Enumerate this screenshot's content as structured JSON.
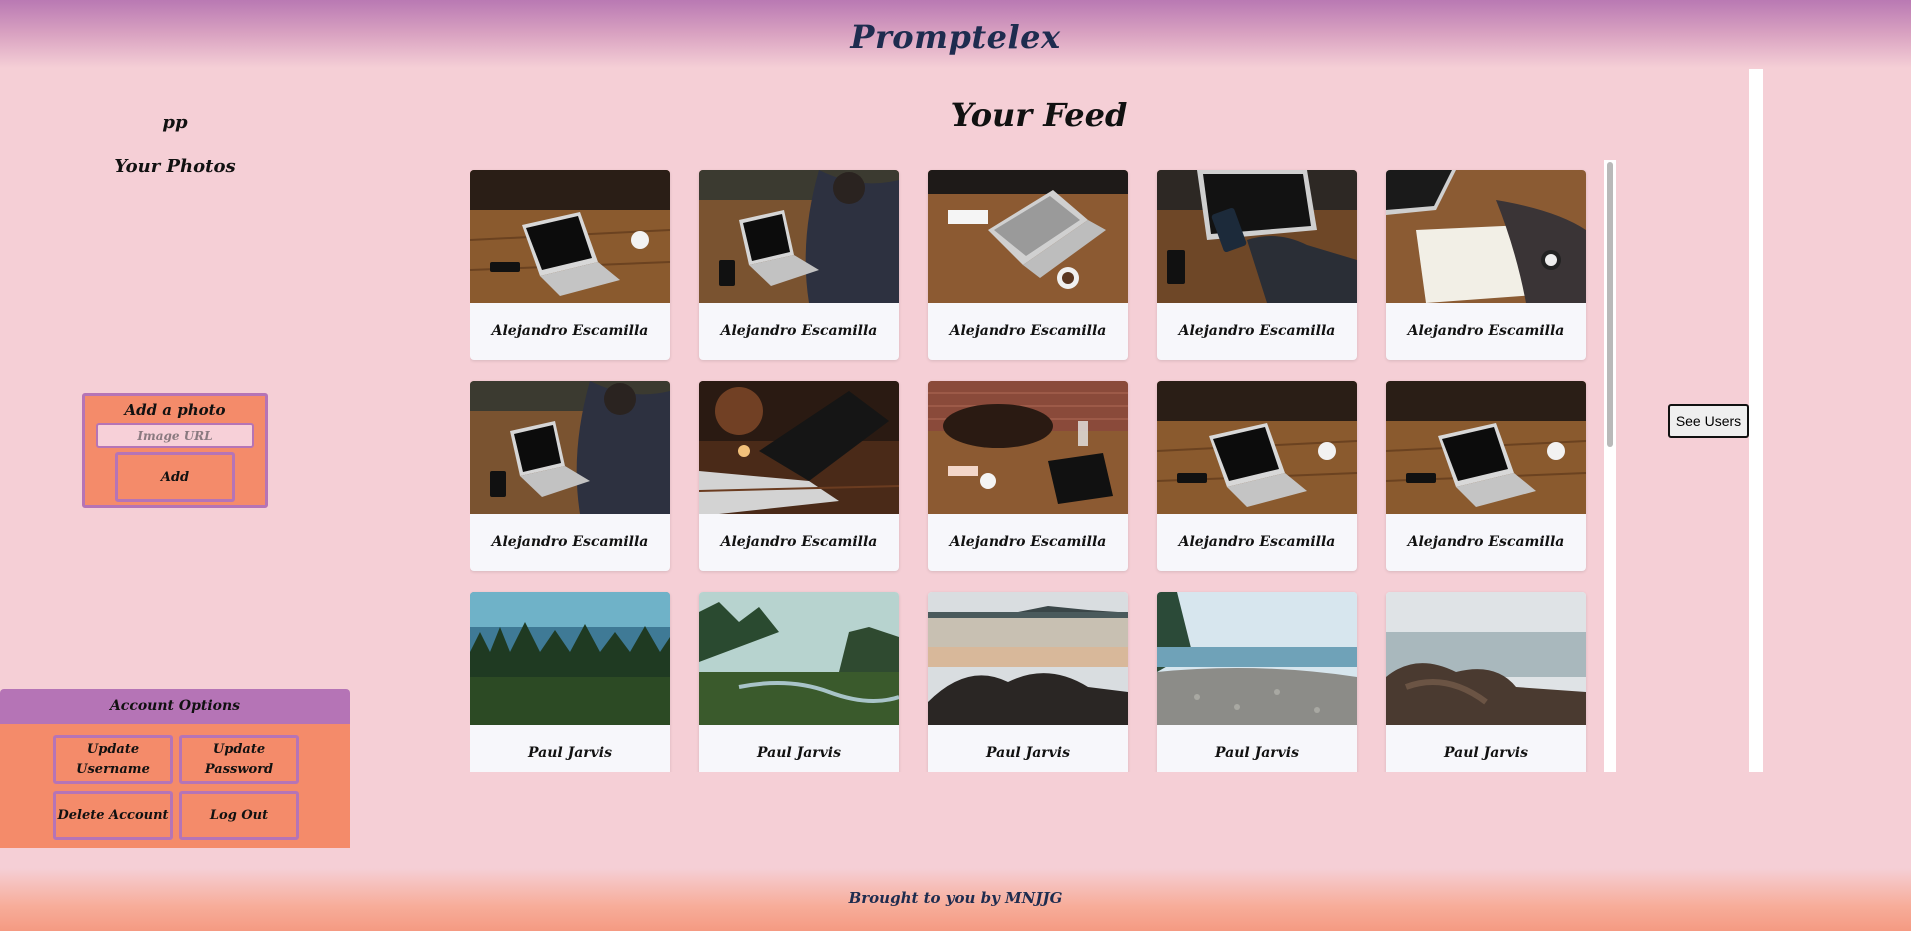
{
  "header": {
    "title": "Promptelex"
  },
  "sidebar": {
    "username": "pp",
    "your_photos_label": "Your Photos",
    "add_photo": {
      "title": "Add a photo",
      "input_placeholder": "Image URL",
      "input_value": "",
      "add_button_label": "Add"
    },
    "account_options": {
      "title": "Account Options",
      "buttons": [
        "Update Username",
        "Update Password",
        "Delete Account",
        "Log Out"
      ]
    }
  },
  "feed": {
    "title": "Your Feed",
    "cards": [
      {
        "author": "Alejandro Escamilla",
        "photo": "laptop-on-table-overhead"
      },
      {
        "author": "Alejandro Escamilla",
        "photo": "person-typing-laptop"
      },
      {
        "author": "Alejandro Escamilla",
        "photo": "laptop-with-coffee"
      },
      {
        "author": "Alejandro Escamilla",
        "photo": "phone-over-laptop"
      },
      {
        "author": "Alejandro Escamilla",
        "photo": "writing-notebook"
      },
      {
        "author": "Alejandro Escamilla",
        "photo": "person-typing-laptop"
      },
      {
        "author": "Alejandro Escamilla",
        "photo": "laptop-dim-table"
      },
      {
        "author": "Alejandro Escamilla",
        "photo": "bag-and-tablet-brick"
      },
      {
        "author": "Alejandro Escamilla",
        "photo": "laptop-on-table-overhead"
      },
      {
        "author": "Alejandro Escamilla",
        "photo": "laptop-on-table-overhead"
      },
      {
        "author": "Paul Jarvis",
        "photo": "forest-lake"
      },
      {
        "author": "Paul Jarvis",
        "photo": "misty-valley"
      },
      {
        "author": "Paul Jarvis",
        "photo": "rocky-beach"
      },
      {
        "author": "Paul Jarvis",
        "photo": "pebble-shore"
      },
      {
        "author": "Paul Jarvis",
        "photo": "coastal-rocks"
      }
    ]
  },
  "see_users_label": "See Users",
  "footer": {
    "text": "Brought to you by MNJJG"
  }
}
